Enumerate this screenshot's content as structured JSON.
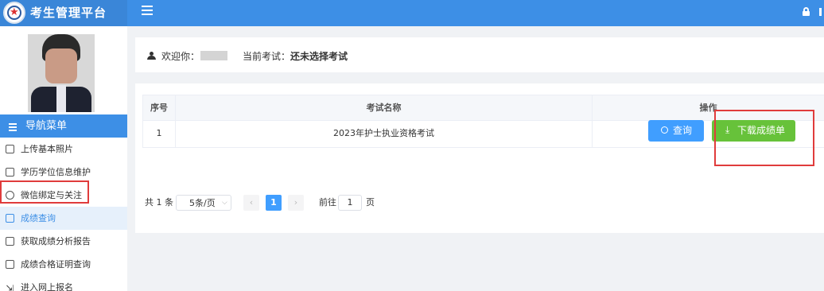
{
  "header": {
    "app_title": "考生管理平台",
    "menu_icon": "hamburger-icon",
    "lock_icon": "lock-icon"
  },
  "sidebar": {
    "nav_title": "导航菜单",
    "items": [
      {
        "label": "上传基本照片",
        "icon": "image-icon",
        "active": false
      },
      {
        "label": "学历学位信息维护",
        "icon": "book-icon",
        "active": false
      },
      {
        "label": "微信绑定与关注",
        "icon": "wechat-icon",
        "active": false
      },
      {
        "label": "成绩查询",
        "icon": "document-chart-icon",
        "active": true
      },
      {
        "label": "获取成绩分析报告",
        "icon": "report-icon",
        "active": false
      },
      {
        "label": "成绩合格证明查询",
        "icon": "certificate-icon",
        "active": false
      },
      {
        "label": "进入网上报名",
        "icon": "enter-icon",
        "active": false
      }
    ]
  },
  "welcome": {
    "greeting": "欢迎你：",
    "exam_label": "当前考试：",
    "exam_value": "还未选择考试"
  },
  "table": {
    "columns": [
      "序号",
      "考试名称",
      "操作"
    ],
    "rows": [
      {
        "index": "1",
        "name": "2023年护士执业资格考试"
      }
    ],
    "query_button": "查询",
    "download_button": "下载成绩单"
  },
  "pagination": {
    "total": "共 1 条",
    "page_size": "5条/页",
    "current_page": "1",
    "goto_label": "前往",
    "goto_value": "1",
    "page_suffix": "页"
  },
  "colors": {
    "primary": "#3d8fe6",
    "success": "#67c23a",
    "highlight_box": "#e03c3c"
  }
}
